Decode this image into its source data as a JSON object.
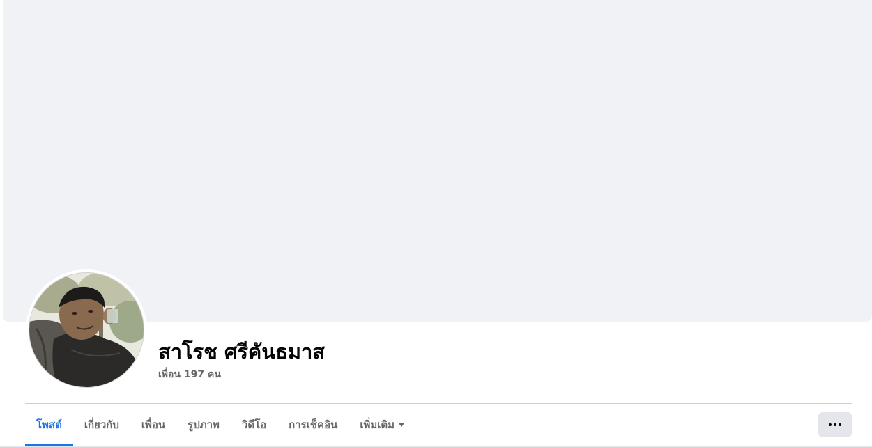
{
  "profile": {
    "name": "สาโรช ศรีคันธมาส",
    "friends_text": "เพื่อน 197 คน"
  },
  "tabs": [
    {
      "label": "โพสต์",
      "active": true
    },
    {
      "label": "เกี่ยวกับ",
      "active": false
    },
    {
      "label": "เพื่อน",
      "active": false
    },
    {
      "label": "รูปภาพ",
      "active": false
    },
    {
      "label": "วิดีโอ",
      "active": false
    },
    {
      "label": "การเช็คอิน",
      "active": false
    },
    {
      "label": "เพิ่มเติม",
      "active": false
    }
  ],
  "icons": {
    "more_tab_caret": "chevron-down-icon",
    "more_options": "more-horizontal-icon"
  },
  "colors": {
    "cover_background": "#f0f2f5",
    "accent": "#1b74e4",
    "secondary_text": "#65676b",
    "button_background": "#e4e6eb"
  }
}
